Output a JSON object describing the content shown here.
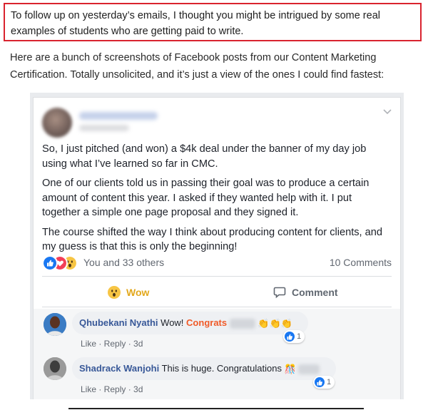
{
  "email": {
    "highlight_text": "To follow up on yesterday’s emails, I thought you might be intrigued by some real examples of students who are getting paid to write.",
    "intro_text": "Here are a bunch of screenshots of Facebook posts from our Content Marketing Certification. Totally unsolicited, and it’s just a view of the ones I could find fastest:"
  },
  "post": {
    "paragraphs": [
      "So, I just pitched (and won) a $4k deal under the banner of my day job using what I’ve learned so far in CMC.",
      "One of our clients told us in passing their goal was to produce a certain amount of content this year. I asked if they wanted help with it. I put together a simple one page proposal and they signed it.",
      "The course shifted the way I think about producing content for clients, and my guess is that this is only the beginning!"
    ],
    "reactions": {
      "icons": [
        "like-reaction-icon",
        "love-reaction-icon",
        "wow-reaction-icon"
      ],
      "summary": "You and 33 others",
      "comments_count": "10 Comments"
    },
    "actions": {
      "wow_label": "Wow",
      "comment_label": "Comment"
    }
  },
  "comments": [
    {
      "name": "Qhubekani Nyathi",
      "text": "Wow!",
      "accent": "Congrats",
      "emoji": "👏👏👏",
      "actions": "Like · Reply · 3d",
      "like_count": "1"
    },
    {
      "name": "Shadrack Wanjohi",
      "text": "This is huge. Congratulations",
      "emoji": "🎊",
      "actions": "Like · Reply · 3d",
      "like_count": "1"
    }
  ],
  "colors": {
    "highlight_border": "#d9232e",
    "facebook_blue": "#1877f2",
    "link_blue": "#385898",
    "wow_yellow": "#e2a81c",
    "congrats_orange": "#f05a28"
  }
}
